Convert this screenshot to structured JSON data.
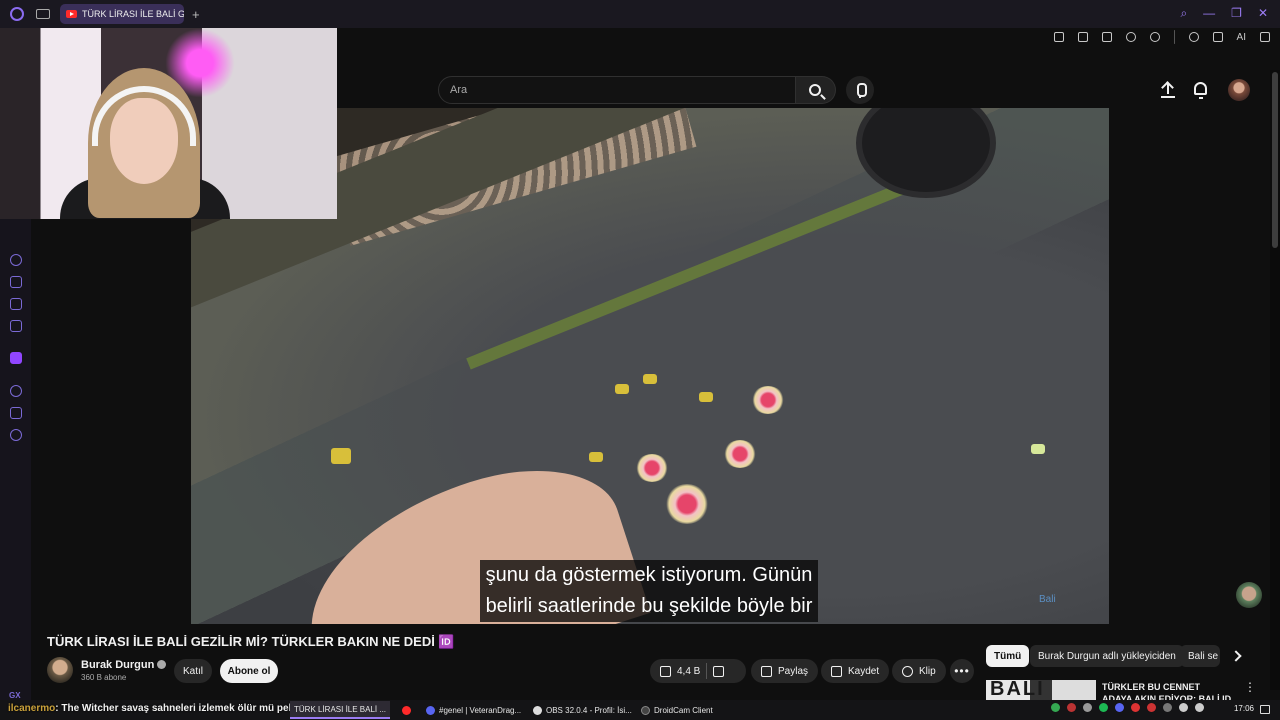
{
  "browser": {
    "tab_title": "TÜRK LİRASI İLE BALİ G",
    "tab_add": "+",
    "window_controls": [
      "search-icon",
      "minimize-icon",
      "restore-icon",
      "close-icon"
    ],
    "ai_label": "AI"
  },
  "youtube": {
    "search": {
      "placeholder": "Ara"
    },
    "video": {
      "caption_line1": "şunu da göstermek istiyorum. Günün",
      "caption_line2": "belirli saatlerinde bu şekilde böyle bir",
      "watermark": "Bali"
    },
    "title": "TÜRK LİRASI İLE BALİ GEZİLİR Mİ? TÜRKLER BAKIN NE DEDİ 🆔",
    "channel": {
      "name": "Burak Durgun",
      "subscribers": "360 B abone"
    },
    "join_label": "Katıl",
    "subscribe_label": "Abone ol",
    "actions": {
      "like_count": "4,4 B",
      "share_label": "Paylaş",
      "save_label": "Kaydet",
      "clip_label": "Klip",
      "more": "•••"
    },
    "chips": [
      "Tümü",
      "Burak Durgun adlı yükleyiciden",
      "Bali se"
    ],
    "recommendation": {
      "thumb_text": "BALİ",
      "title": "TÜRKLER BU CENNET ADAYA AKIN EDİYOR: BALİ ID",
      "more": "⋮"
    }
  },
  "taskbar": {
    "notification_user": "ilcanermo",
    "notification_text": ": The Witcher savaş sahneleri izlemek ölür mü peki",
    "tasks": [
      {
        "label": "TÜRK LİRASI İLE BALİ ...",
        "color": "#ff2a2a"
      },
      {
        "label": "#genel | VeteranDrag...",
        "color": "#5865f2"
      },
      {
        "label": "OBS 32.0.4 - Profil: İsi...",
        "color": "#dddddd"
      },
      {
        "label": "DroidCam Client",
        "color": "#444444"
      }
    ],
    "clock": "17:06"
  }
}
